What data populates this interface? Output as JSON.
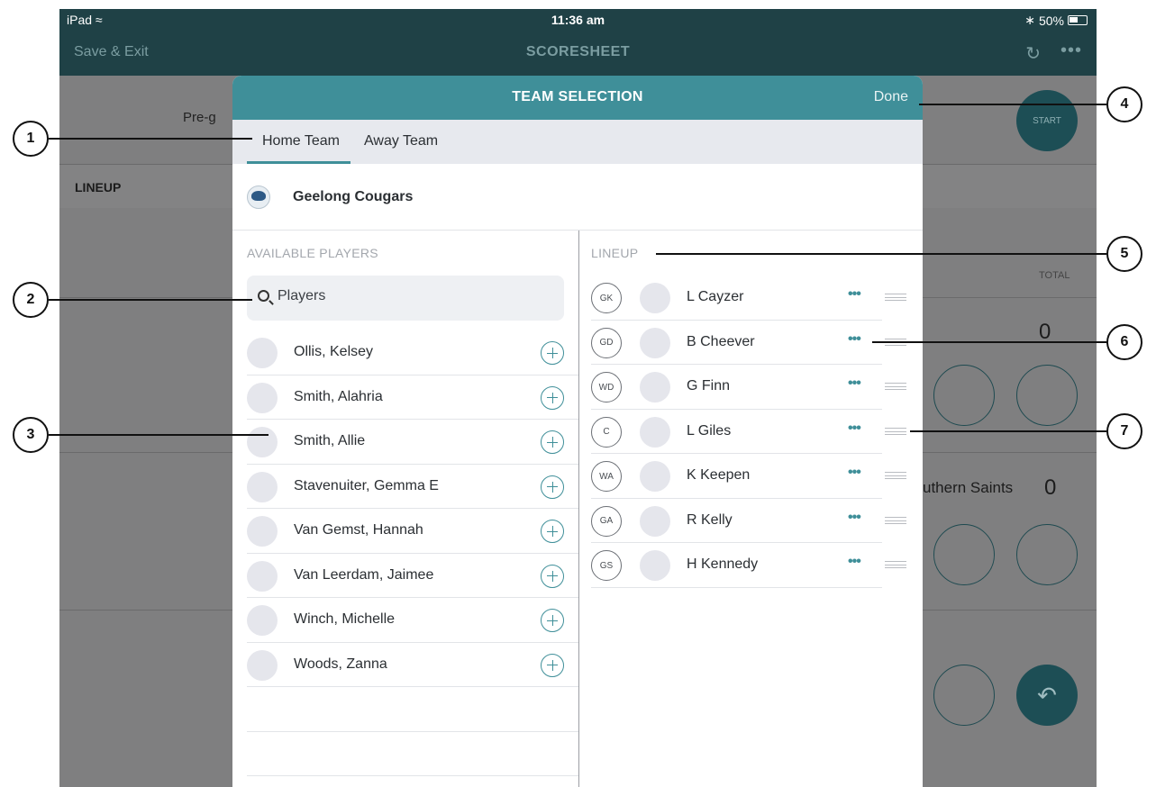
{
  "status_bar": {
    "device": "iPad",
    "time": "11:36 am",
    "battery": "50%"
  },
  "nav": {
    "left_label": "Save & Exit",
    "title": "SCORESHEET",
    "refresh_icon": "refresh-icon",
    "more_icon": "more-icon"
  },
  "background": {
    "pregame_label": "Pre-g",
    "start_label": "START",
    "lineup_label": "LINEUP",
    "total_label": "TOTAL",
    "score_home": "0",
    "opponent_name": "uthern Saints",
    "score_away": "0",
    "undo_icon": "undo-icon"
  },
  "modal": {
    "title": "TEAM SELECTION",
    "done_label": "Done",
    "tabs": [
      {
        "label": "Home Team",
        "active": true
      },
      {
        "label": "Away Team",
        "active": false
      }
    ],
    "team_name": "Geelong Cougars",
    "available_label": "AVAILABLE PLAYERS",
    "lineup_label": "LINEUP",
    "search": {
      "placeholder": "Players",
      "value": ""
    },
    "available_players": [
      {
        "name": "Ollis, Kelsey"
      },
      {
        "name": "Smith, Alahria"
      },
      {
        "name": "Smith, Allie"
      },
      {
        "name": "Stavenuiter, Gemma E"
      },
      {
        "name": "Van Gemst, Hannah"
      },
      {
        "name": "Van Leerdam, Jaimee"
      },
      {
        "name": "Winch, Michelle"
      },
      {
        "name": "Woods, Zanna"
      }
    ],
    "lineup": [
      {
        "position": "GK",
        "name": "L Cayzer"
      },
      {
        "position": "GD",
        "name": "B Cheever"
      },
      {
        "position": "WD",
        "name": "G Finn"
      },
      {
        "position": "C",
        "name": "L Giles"
      },
      {
        "position": "WA",
        "name": "K Keepen"
      },
      {
        "position": "GA",
        "name": "R Kelly"
      },
      {
        "position": "GS",
        "name": "H Kennedy"
      }
    ]
  },
  "callouts": [
    "1",
    "2",
    "3",
    "4",
    "5",
    "6",
    "7"
  ],
  "colors": {
    "header_teal": "#3f8f99",
    "nav_dark": "#1f4146",
    "accent": "#3f8f99"
  }
}
